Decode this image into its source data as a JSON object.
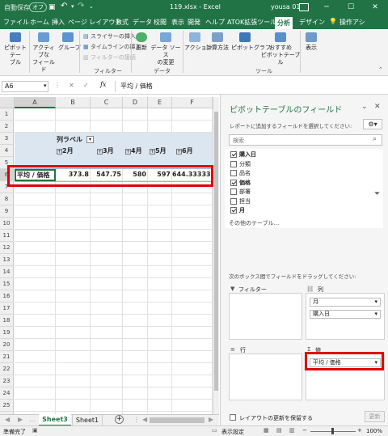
{
  "titlebar": {
    "autosave": "自動保存",
    "autosave_state": "オフ",
    "filename": "119.xlsx - Excel",
    "user": "yousa 01",
    "undo": "↶",
    "redo": "↷"
  },
  "tabs": [
    "ファイル",
    "ホーム",
    "挿入",
    "ページ レイアウト",
    "数式",
    "データ",
    "校閲",
    "表示",
    "開発",
    "ヘルプ",
    "ATOK拡張ツール",
    "分析",
    "デザイン"
  ],
  "active_tab": "分析",
  "tell_me": "操作アシ",
  "ribbon": {
    "pivot_table": "ピボットテー\nブル",
    "active_field": "アクティブな\nフィールド",
    "group": "グループ",
    "insert_slicer": "スライサーの挿入",
    "insert_timeline": "タイムラインの挿入",
    "filter_connections": "フィルターの接続",
    "filter_group": "フィルター",
    "refresh": "更新",
    "change_source": "データ ソース\nの変更",
    "data_group": "データ",
    "actions": "アクション",
    "calculations": "計算方法",
    "pivot_chart": "ピボットグラフ",
    "recommended": "おすすめ\nピボットテーブル",
    "tools_group": "ツール",
    "show": "表示"
  },
  "formula_bar": {
    "name_box": "A6",
    "fx": "fx",
    "cancel": "✕",
    "enter": "✓",
    "content": "平均 / 価格"
  },
  "grid": {
    "columns": [
      "A",
      "B",
      "C",
      "D",
      "E",
      "F"
    ],
    "rows": [
      "1",
      "2",
      "3",
      "4",
      "5",
      "6",
      "7",
      "8",
      "9",
      "10",
      "11",
      "12",
      "13",
      "14",
      "15",
      "16",
      "17",
      "18",
      "19",
      "20",
      "21",
      "22",
      "23",
      "24",
      "25",
      "26",
      "27"
    ],
    "col_label": "列ラベル",
    "months": [
      "2月",
      "3月",
      "4月",
      "5月",
      "6月"
    ],
    "row_label": "平均 / 価格",
    "values": [
      "373.8",
      "547.75",
      "580",
      "597",
      "644.333333"
    ]
  },
  "sheets": [
    "Sheet3",
    "Sheet1"
  ],
  "active_sheet": "Sheet3",
  "status": {
    "ready": "準備完了",
    "display_settings": "表示設定",
    "zoom": "100%"
  },
  "pane": {
    "title": "ピボットテーブルのフィールド",
    "subtitle": "レポートに追加するフィールドを選択してください:",
    "search_placeholder": "検索",
    "fields": [
      {
        "name": "購入日",
        "checked": true,
        "bold": true
      },
      {
        "name": "分類",
        "checked": false,
        "bold": false
      },
      {
        "name": "品名",
        "checked": false,
        "bold": false
      },
      {
        "name": "価格",
        "checked": true,
        "bold": true
      },
      {
        "name": "部署",
        "checked": false,
        "bold": false
      },
      {
        "name": "担当",
        "checked": false,
        "bold": false
      },
      {
        "name": "月",
        "checked": true,
        "bold": true
      }
    ],
    "more_tables": "その他のテーブル...",
    "drag_hint": "次のボックス間でフィールドをドラッグしてください:",
    "filters_label": "フィルター",
    "columns_label": "列",
    "rows_label": "行",
    "values_label": "値",
    "column_items": [
      "月",
      "購入日"
    ],
    "value_items": [
      "平均 / 価格"
    ],
    "defer_label": "レイアウトの更新を保留する",
    "update_button": "更新"
  },
  "colors": {
    "excel_green": "#217346",
    "pivot_header": "#dce6f1",
    "highlight": "#e00000"
  }
}
